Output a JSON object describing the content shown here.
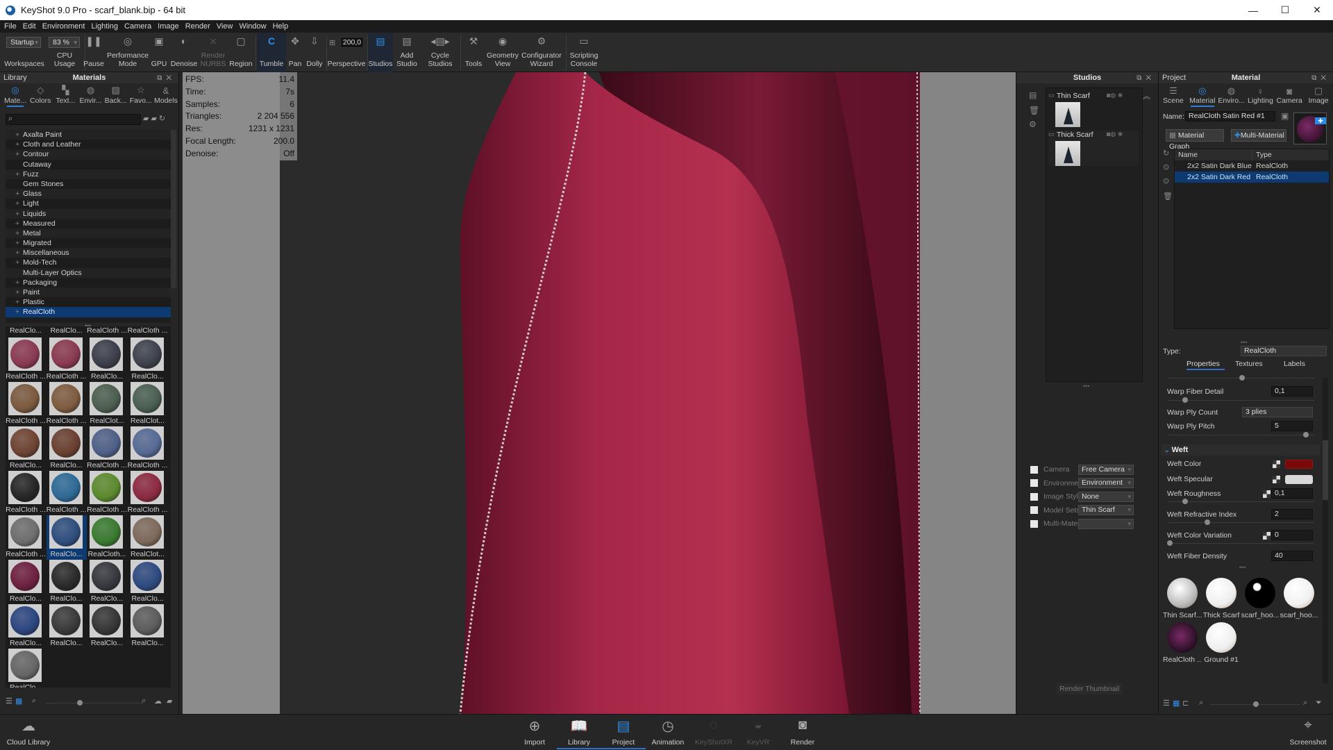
{
  "window": {
    "title": "KeyShot 9.0 Pro  - scarf_blank.bip  - 64 bit",
    "min": "—",
    "max": "☐",
    "close": "✕"
  },
  "menu": [
    "File",
    "Edit",
    "Environment",
    "Lighting",
    "Camera",
    "Image",
    "Render",
    "View",
    "Window",
    "Help"
  ],
  "toolbar": {
    "workspace_value": "Startup",
    "workspace_label": "Workspaces",
    "cpu_value": "83 %",
    "cpu_label": "CPU Usage",
    "pause": "Pause",
    "performance": "Performance Mode",
    "gpu": "GPU",
    "denoise": "Denoise",
    "render_nurbs": "Render NURBS",
    "region": "Region",
    "tumble": "Tumble",
    "pan": "Pan",
    "dolly": "Dolly",
    "focal_value": "200,0",
    "perspective": "Perspective",
    "studios": "Studios",
    "add_studio": "Add Studio",
    "cycle_studios": "Cycle Studios",
    "tools": "Tools",
    "geometry_view": "Geometry View",
    "configurator": "Configurator Wizard",
    "scripting": "Scripting Console"
  },
  "library": {
    "panel_label": "Library",
    "title": "Materials",
    "tabs": [
      "Mate...",
      "Colors",
      "Text...",
      "Envir...",
      "Back...",
      "Favo...",
      "Models"
    ],
    "search_placeholder": "",
    "tree": [
      {
        "label": "Axalta Paint",
        "expandable": true
      },
      {
        "label": "Cloth and Leather",
        "expandable": true
      },
      {
        "label": "Contour",
        "expandable": true
      },
      {
        "label": "Cutaway",
        "expandable": false
      },
      {
        "label": "Fuzz",
        "expandable": true
      },
      {
        "label": "Gem Stones",
        "expandable": false
      },
      {
        "label": "Glass",
        "expandable": true
      },
      {
        "label": "Light",
        "expandable": true
      },
      {
        "label": "Liquids",
        "expandable": true
      },
      {
        "label": "Measured",
        "expandable": true
      },
      {
        "label": "Metal",
        "expandable": true
      },
      {
        "label": "Migrated",
        "expandable": true
      },
      {
        "label": "Miscellaneous",
        "expandable": true
      },
      {
        "label": "Mold-Tech",
        "expandable": true
      },
      {
        "label": "Multi-Layer Optics",
        "expandable": false
      },
      {
        "label": "Packaging",
        "expandable": true
      },
      {
        "label": "Paint",
        "expandable": true
      },
      {
        "label": "Plastic",
        "expandable": true
      },
      {
        "label": "RealCloth",
        "expandable": true,
        "selected": true
      }
    ],
    "top_row_labels": [
      "RealClo...",
      "RealClo...",
      "RealCloth ...",
      "RealCloth ..."
    ],
    "thumbnails": [
      {
        "label": "RealCloth ...",
        "color": "#8a3a52"
      },
      {
        "label": "RealCloth ...",
        "color": "#8a3a50"
      },
      {
        "label": "RealClo...",
        "color": "#3c3f4a"
      },
      {
        "label": "RealClo...",
        "color": "#3e424c"
      },
      {
        "label": "RealCloth ...",
        "color": "#7b5a3e"
      },
      {
        "label": "RealCloth ...",
        "color": "#7e5c40"
      },
      {
        "label": "RealClot...",
        "color": "#4c5e4f"
      },
      {
        "label": "RealClot...",
        "color": "#4a5f52"
      },
      {
        "label": "RealClo...",
        "color": "#6e4433"
      },
      {
        "label": "RealClo...",
        "color": "#6a4030"
      },
      {
        "label": "RealCloth ...",
        "color": "#4f6088"
      },
      {
        "label": "RealCloth ...",
        "color": "#566a94"
      },
      {
        "label": "RealCloth ...",
        "color": "#262626"
      },
      {
        "label": "RealCloth ...",
        "color": "#2e6a96"
      },
      {
        "label": "RealCloth ...",
        "color": "#5c8a2e"
      },
      {
        "label": "RealCloth ...",
        "color": "#8c2a40"
      },
      {
        "label": "RealCloth ...",
        "color": "#6e6e6e"
      },
      {
        "label": "RealClo...",
        "color": "#2f4e7e",
        "selected": true
      },
      {
        "label": "RealCloth...",
        "color": "#3a7a30"
      },
      {
        "label": "RealClot...",
        "color": "#7e6a5c"
      },
      {
        "label": "RealClo...",
        "color": "#6e2040"
      },
      {
        "label": "RealClo...",
        "color": "#2a2a2a"
      },
      {
        "label": "RealClo...",
        "color": "#36383e"
      },
      {
        "label": "RealClo...",
        "color": "#2e4a80"
      },
      {
        "label": "RealClo...",
        "color": "#2c4680"
      },
      {
        "label": "RealClo...",
        "color": "#3a3a3a"
      },
      {
        "label": "RealClo...",
        "color": "#363636"
      },
      {
        "label": "RealClo...",
        "color": "#5c5c5c"
      },
      {
        "label": "RealClo...",
        "color": "#666666"
      }
    ]
  },
  "hud": [
    {
      "k": "FPS:",
      "v": "11.4"
    },
    {
      "k": "Time:",
      "v": "7s"
    },
    {
      "k": "Samples:",
      "v": "6"
    },
    {
      "k": "Triangles:",
      "v": "2 204 556"
    },
    {
      "k": "Res:",
      "v": "1231 x 1231"
    },
    {
      "k": "Focal Length:",
      "v": "200.0"
    },
    {
      "k": "Denoise:",
      "v": "Off"
    }
  ],
  "studios": {
    "title": "Studios",
    "items": [
      {
        "name": "Thin Scarf"
      },
      {
        "name": "Thick Scarf"
      }
    ],
    "settings": [
      {
        "label": "Camera",
        "value": "Free Camera"
      },
      {
        "label": "Environment",
        "value": "Environment"
      },
      {
        "label": "Image Style",
        "value": "None"
      },
      {
        "label": "Model Sets",
        "value": "Thin Scarf"
      },
      {
        "label": "Multi-Materials",
        "value": ""
      }
    ],
    "render_thumbnail": "Render Thumbnail"
  },
  "project": {
    "panel_label": "Project",
    "title": "Material",
    "tabs": [
      "Scene",
      "Material",
      "Enviro...",
      "Lighting",
      "Camera",
      "Image"
    ],
    "name_label": "Name:",
    "name_value": "RealCloth Satin Red #1",
    "material_graph": "Material Graph",
    "multi_material": "Multi-Material",
    "list_headers": [
      "Name",
      "Type"
    ],
    "list": [
      {
        "name": "2x2 Satin Dark Blue",
        "type": "RealCloth"
      },
      {
        "name": "2x2 Satin Dark Red",
        "type": "RealCloth",
        "selected": true
      }
    ],
    "type_label": "Type:",
    "type_value": "RealCloth",
    "subtabs": [
      "Properties",
      "Textures",
      "Labels"
    ],
    "props": {
      "warp_fiber_detail": {
        "label": "Warp Fiber Detail",
        "value": "0,1"
      },
      "warp_ply_count": {
        "label": "Warp Ply Count",
        "value": "3 plies"
      },
      "warp_ply_pitch": {
        "label": "Warp Ply Pitch",
        "value": "5"
      },
      "weft_section": "Weft",
      "weft_color": {
        "label": "Weft Color",
        "color": "#7a0a0a"
      },
      "weft_specular": {
        "label": "Weft Specular",
        "color": "#d8d8d8"
      },
      "weft_roughness": {
        "label": "Weft Roughness",
        "value": "0,1"
      },
      "weft_refractive_index": {
        "label": "Weft Refractive Index",
        "value": "2"
      },
      "weft_color_variation": {
        "label": "Weft Color Variation",
        "value": "0"
      },
      "weft_fiber_density": {
        "label": "Weft Fiber Density",
        "value": "40"
      }
    },
    "materials": [
      {
        "label": "Thin Scarf..."
      },
      {
        "label": "Thick Scarf"
      },
      {
        "label": "scarf_hoo..."
      },
      {
        "label": "scarf_hoo..."
      },
      {
        "label": "RealCloth ..."
      },
      {
        "label": "Ground #1"
      }
    ]
  },
  "dock": {
    "cloud_library": "Cloud Library",
    "import": "Import",
    "library": "Library",
    "project": "Project",
    "animation": "Animation",
    "keyshotxr": "KeyShotXR",
    "keyvr": "KeyVR",
    "render": "Render",
    "screenshot": "Screenshot"
  }
}
